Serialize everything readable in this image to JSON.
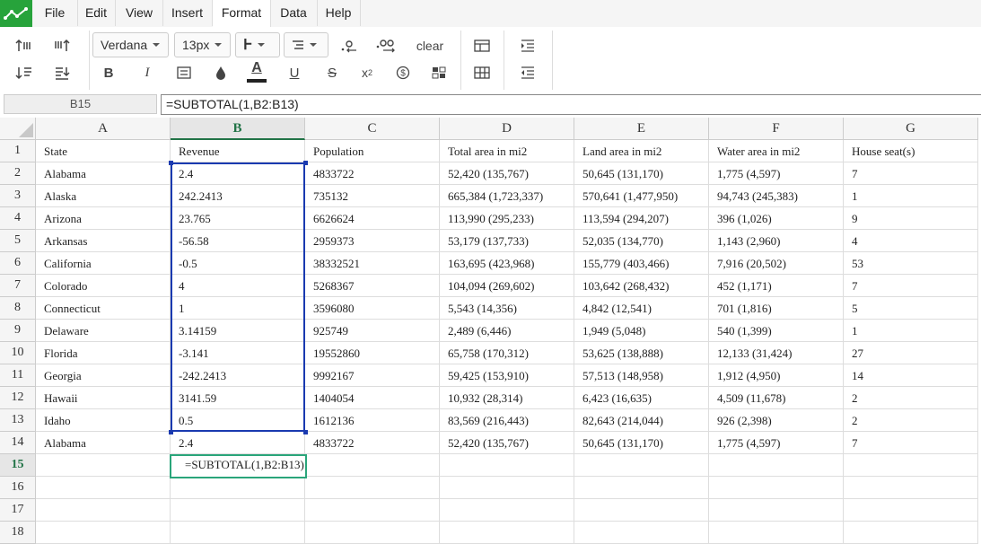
{
  "menu": {
    "items": [
      "File",
      "Edit",
      "View",
      "Insert",
      "Format",
      "Data",
      "Help"
    ],
    "active": "Format"
  },
  "toolbar": {
    "font_family": "Verdana",
    "font_size": "13px",
    "clear_label": "clear",
    "text_color": "#222222"
  },
  "formula_bar": {
    "cell_ref": "B15",
    "formula": "=SUBTOTAL(1,B2:B13)"
  },
  "sheet": {
    "columns": [
      "A",
      "B",
      "C",
      "D",
      "E",
      "F",
      "G"
    ],
    "selected_column": "B",
    "selected_row": "15",
    "rows": [
      {
        "n": "1",
        "cells": [
          "State",
          "Revenue",
          "Population",
          "Total area in mi2",
          "Land area in mi2",
          "Water area in mi2",
          "House seat(s)"
        ]
      },
      {
        "n": "2",
        "cells": [
          "Alabama",
          "2.4",
          "4833722",
          "52,420 (135,767)",
          "50,645 (131,170)",
          "1,775 (4,597)",
          "7"
        ]
      },
      {
        "n": "3",
        "cells": [
          "Alaska",
          "242.2413",
          "735132",
          "665,384 (1,723,337)",
          "570,641 (1,477,950)",
          "94,743 (245,383)",
          "1"
        ]
      },
      {
        "n": "4",
        "cells": [
          "Arizona",
          "23.765",
          "6626624",
          "113,990 (295,233)",
          "113,594 (294,207)",
          "396 (1,026)",
          "9"
        ]
      },
      {
        "n": "5",
        "cells": [
          "Arkansas",
          "-56.58",
          "2959373",
          "53,179 (137,733)",
          "52,035 (134,770)",
          "1,143 (2,960)",
          "4"
        ]
      },
      {
        "n": "6",
        "cells": [
          "California",
          "-0.5",
          "38332521",
          "163,695 (423,968)",
          "155,779 (403,466)",
          "7,916 (20,502)",
          "53"
        ]
      },
      {
        "n": "7",
        "cells": [
          "Colorado",
          "4",
          "5268367",
          "104,094 (269,602)",
          "103,642 (268,432)",
          "452 (1,171)",
          "7"
        ]
      },
      {
        "n": "8",
        "cells": [
          "Connecticut",
          "1",
          "3596080",
          "5,543 (14,356)",
          "4,842 (12,541)",
          "701 (1,816)",
          "5"
        ]
      },
      {
        "n": "9",
        "cells": [
          "Delaware",
          "3.14159",
          "925749",
          "2,489 (6,446)",
          "1,949 (5,048)",
          "540 (1,399)",
          "1"
        ]
      },
      {
        "n": "10",
        "cells": [
          "Florida",
          "-3.141",
          "19552860",
          "65,758 (170,312)",
          "53,625 (138,888)",
          "12,133 (31,424)",
          "27"
        ]
      },
      {
        "n": "11",
        "cells": [
          "Georgia",
          "-242.2413",
          "9992167",
          "59,425 (153,910)",
          "57,513 (148,958)",
          "1,912 (4,950)",
          "14"
        ]
      },
      {
        "n": "12",
        "cells": [
          "Hawaii",
          "3141.59",
          "1404054",
          "10,932 (28,314)",
          "6,423 (16,635)",
          "4,509 (11,678)",
          "2"
        ]
      },
      {
        "n": "13",
        "cells": [
          "Idaho",
          "0.5",
          "1612136",
          "83,569 (216,443)",
          "82,643 (214,044)",
          "926 (2,398)",
          "2"
        ]
      },
      {
        "n": "14",
        "cells": [
          "Alabama",
          "2.4",
          "4833722",
          "52,420 (135,767)",
          "50,645 (131,170)",
          "1,775 (4,597)",
          "7"
        ]
      },
      {
        "n": "15",
        "cells": [
          "",
          "",
          "",
          "",
          "",
          "",
          ""
        ]
      },
      {
        "n": "16",
        "cells": [
          "",
          "",
          "",
          "",
          "",
          "",
          ""
        ]
      },
      {
        "n": "17",
        "cells": [
          "",
          "",
          "",
          "",
          "",
          "",
          ""
        ]
      },
      {
        "n": "18",
        "cells": [
          "",
          "",
          "",
          "",
          "",
          "",
          ""
        ]
      }
    ],
    "editor_value": "=SUBTOTAL(1,B2:B13)"
  }
}
